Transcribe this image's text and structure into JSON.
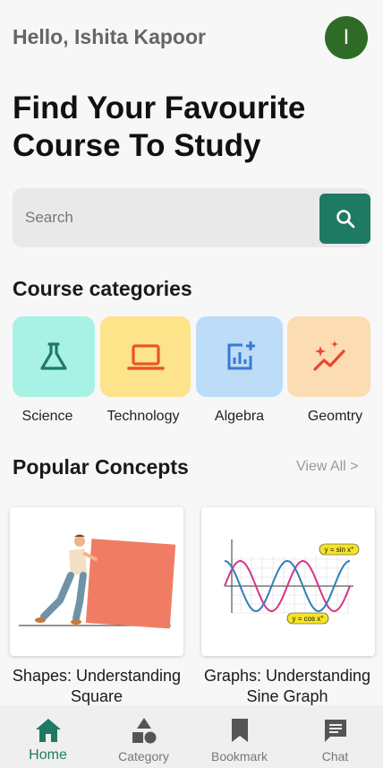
{
  "header": {
    "greeting": "Hello, Ishita Kapoor",
    "avatar_initial": "I"
  },
  "hero": {
    "title": "Find Your Favourite Course To Study"
  },
  "search": {
    "placeholder": "Search",
    "value": "",
    "button_icon": "search-icon"
  },
  "categories": {
    "title": "Course categories",
    "items": [
      {
        "label": "Science",
        "icon": "flask-icon",
        "bg": "#a7f2e4",
        "color": "#1f7a63"
      },
      {
        "label": "Technology",
        "icon": "laptop-icon",
        "bg": "#fde38a",
        "color": "#e8552a"
      },
      {
        "label": "Algebra",
        "icon": "chart-add-icon",
        "bg": "#bcdcf7",
        "color": "#3a78d6"
      },
      {
        "label": "Geomtry",
        "icon": "sparkle-trend-icon",
        "bg": "#fcdcb2",
        "color": "#e8462f"
      }
    ]
  },
  "popular": {
    "title": "Popular Concepts",
    "view_all": "View All >",
    "items": [
      {
        "title": "Shapes: Understanding Square"
      },
      {
        "title": "Graphs: Understanding Sine Graph",
        "label_sin": "y = sin x°",
        "label_cos": "y = cos x°"
      }
    ]
  },
  "nav": {
    "items": [
      {
        "label": "Home",
        "icon": "home-icon",
        "active": true
      },
      {
        "label": "Category",
        "icon": "shapes-icon",
        "active": false
      },
      {
        "label": "Bookmark",
        "icon": "bookmark-icon",
        "active": false
      },
      {
        "label": "Chat",
        "icon": "chat-icon",
        "active": false
      }
    ]
  },
  "colors": {
    "accent": "#1f7a63",
    "avatar": "#2e6b27",
    "sin_curve": "#d6338a",
    "cos_curve": "#2f7fb5"
  }
}
